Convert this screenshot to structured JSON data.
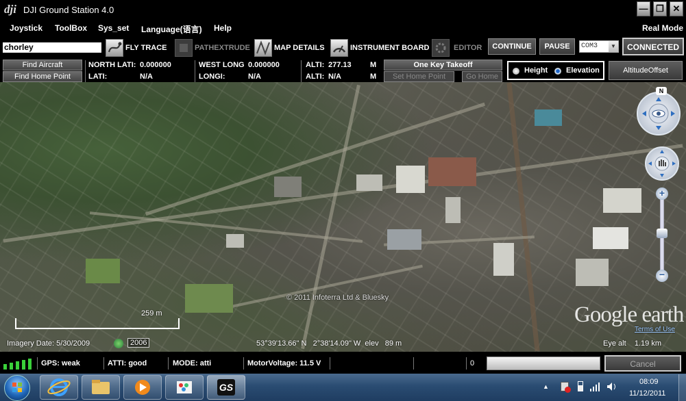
{
  "window": {
    "title": "DJI Ground Station 4.0",
    "logo": "dji",
    "buttons": {
      "minimize": "—",
      "maximize": "❐",
      "close": "✕"
    }
  },
  "menu": {
    "items": [
      "Joystick",
      "ToolBox",
      "Sys_set",
      "Language(语言)",
      "Help"
    ],
    "mode": "Real Mode"
  },
  "toolbar": {
    "search_value": "chorley",
    "fly_trace": "FLY TRACE",
    "pathextrude": "PATHEXTRUDE",
    "map_details": "MAP DETAILS",
    "instrument_board": "INSTRUMENT BOARD",
    "editor": "EDITOR",
    "continue": "CONTINUE",
    "pause": "PAUSE",
    "com_port": "COM3",
    "connected": "CONNECTED"
  },
  "info": {
    "find_aircraft": "Find Aircraft",
    "find_home_point": "Find Home Point",
    "north_lati_label": "NORTH LATI:",
    "north_lati_value": "0.000000",
    "west_long_label": "WEST LONG",
    "west_long_value": "0.000000",
    "alti_label": "ALTI:",
    "alti_value": "277.13",
    "alti_unit": "M",
    "one_key_takeoff": "One Key Takeoff",
    "height": "Height",
    "elevation": "Elevation",
    "altitude_offset": "AltitudeOffset",
    "lati_label": "LATI:",
    "lati_value": "N/A",
    "longi_label": "LONGI:",
    "longi_value": "N/A",
    "alti2_label": "ALTI:",
    "alti2_value": "N/A",
    "alti2_unit": "M",
    "set_home_point": "Set Home Point",
    "go_home": "Go Home"
  },
  "map": {
    "copyright": "© 2011 Infoterra Ltd & Bluesky",
    "scale": "259 m",
    "imagery_date": "Imagery Date: 5/30/2009",
    "year": "2006",
    "coords": "53°39'13.66\" N   2°38'14.09\" W  elev   89 m",
    "google_earth": "Google earth",
    "terms": "Terms of Use",
    "eye_alt": "Eye alt    1.19 km",
    "north": "N"
  },
  "status": {
    "gps": "GPS: weak",
    "atti": "ATTI: good",
    "mode": "MODE:  atti",
    "motor_voltage": "MotorVoltage: 11.5 V",
    "counter": "0",
    "cancel": "Cancel",
    "signal_bars": 5
  },
  "taskbar": {
    "clock_time": "08:09",
    "clock_date": "11/12/2011",
    "apps": [
      "start-orb",
      "internet-explorer",
      "file-explorer",
      "media-player",
      "paint",
      "ground-station"
    ],
    "gs_label": "GS"
  },
  "colors": {
    "background": "#000000",
    "taskbar": "#2a4c72",
    "map": "#525548"
  }
}
